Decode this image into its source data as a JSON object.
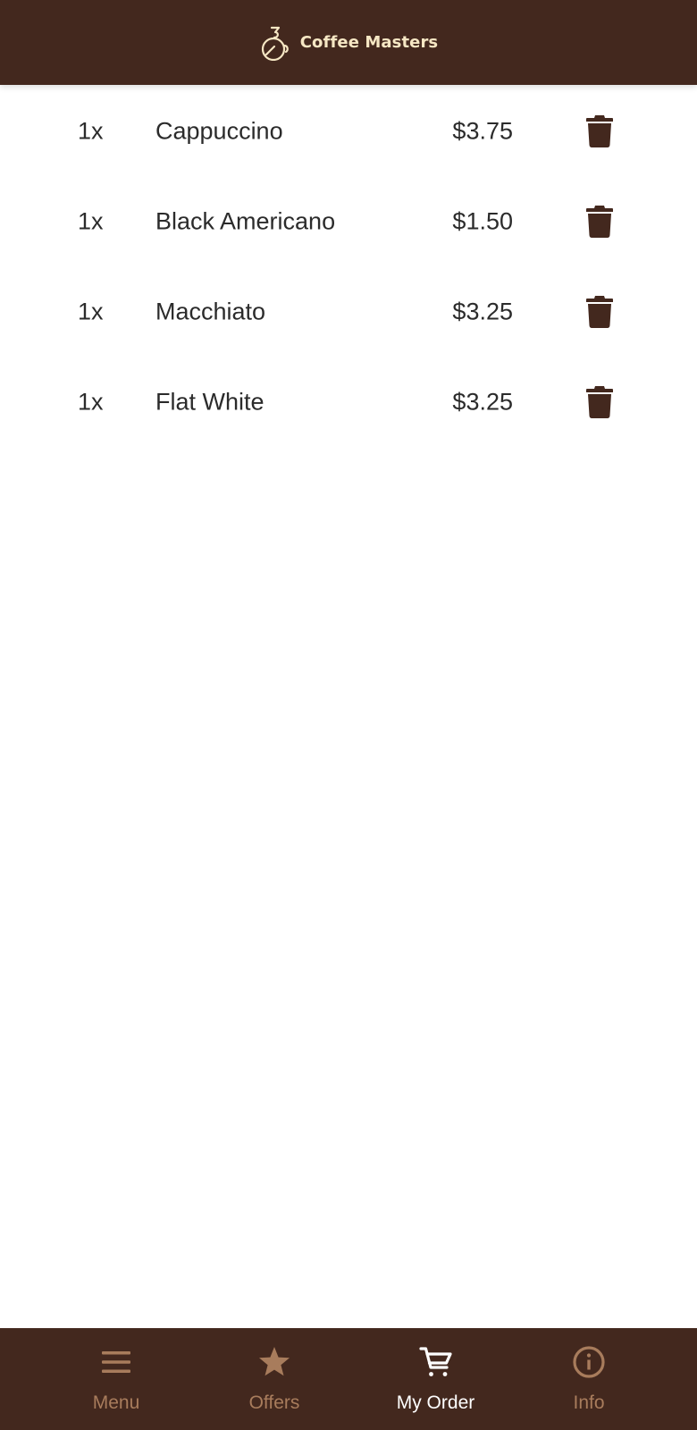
{
  "header": {
    "title": "Coffee Masters",
    "logo_icon": "coffee-cup-logo-icon",
    "background": "#43281e",
    "title_color": "#f6e7c4"
  },
  "order": {
    "items": [
      {
        "quantity": "1x",
        "name": "Cappuccino",
        "price": "$3.75",
        "delete_icon": "trash-icon"
      },
      {
        "quantity": "1x",
        "name": "Black Americano",
        "price": "$1.50",
        "delete_icon": "trash-icon"
      },
      {
        "quantity": "1x",
        "name": "Macchiato",
        "price": "$3.25",
        "delete_icon": "trash-icon"
      },
      {
        "quantity": "1x",
        "name": "Flat White",
        "price": "$3.25",
        "delete_icon": "trash-icon"
      }
    ]
  },
  "nav": {
    "items": [
      {
        "label": "Menu",
        "icon": "hamburger-menu-icon",
        "active": false
      },
      {
        "label": "Offers",
        "icon": "star-icon",
        "active": false
      },
      {
        "label": "My Order",
        "icon": "shopping-cart-icon",
        "active": true
      },
      {
        "label": "Info",
        "icon": "info-icon",
        "active": false
      }
    ],
    "active_color": "#ffffff",
    "inactive_color": "#a87c5c"
  },
  "colors": {
    "brand_brown": "#43281e",
    "text": "#2b2b2b",
    "accent_tan": "#a87c5c"
  }
}
